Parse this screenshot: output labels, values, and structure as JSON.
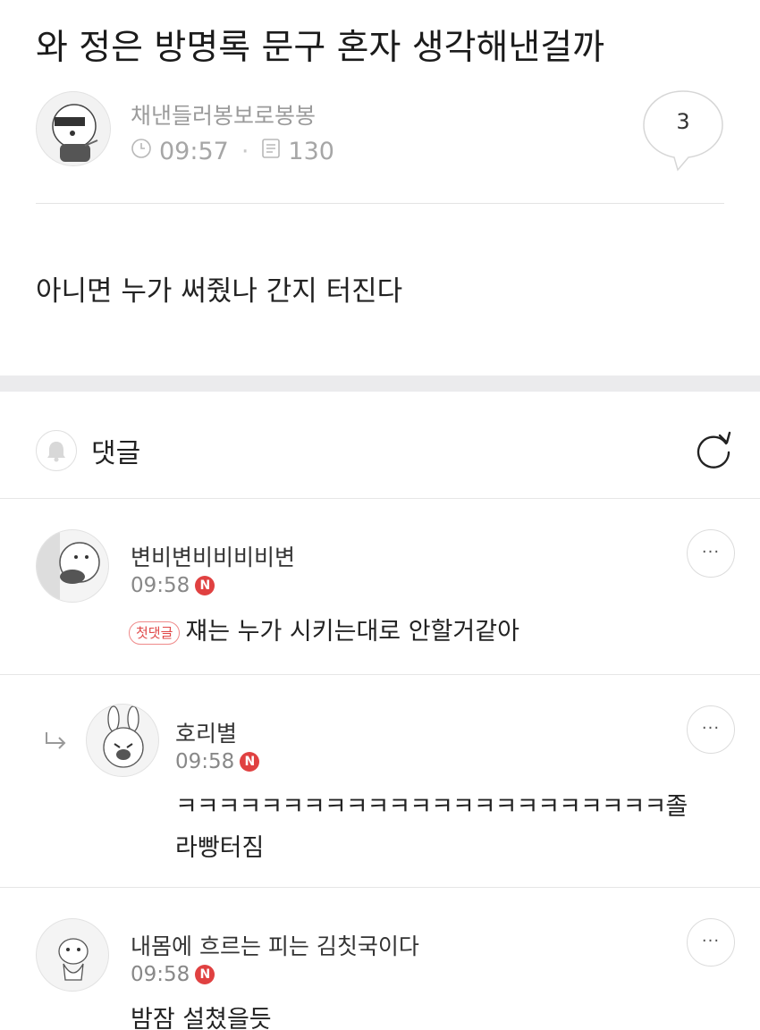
{
  "post": {
    "title": "와 정은 방명록 문구 혼자 생각해낸걸까",
    "author": "채낸들러봉보로봉봉",
    "time": "09:57",
    "views": "130",
    "comment_count": "3",
    "body": "아니면 누가 써줬나 간지 터진다"
  },
  "comments_section": {
    "label": "댓글",
    "items": [
      {
        "name": "변비변비비비비변",
        "time": "09:58",
        "badge": "N",
        "first_comment_label": "첫댓글",
        "text": "쟤는 누가 시키는대로 안할거같아",
        "more": "···"
      },
      {
        "name": "호리별",
        "time": "09:58",
        "badge": "N",
        "text_line1": "ㅋㅋㅋㅋㅋㅋㅋㅋㅋㅋㅋㅋㅋㅋㅋㅋㅋㅋㅋㅋㅋㅋㅋ졸",
        "text_line2": "라빵터짐",
        "more": "···"
      },
      {
        "name": "내몸에 흐르는 피는 김칫국이다",
        "time": "09:58",
        "badge": "N",
        "text": "밤잠 설쳤을듯",
        "more": "···"
      }
    ]
  },
  "icons": {
    "clock": "clock-icon",
    "views": "document-icon",
    "bell": "bell-icon",
    "refresh": "refresh-icon",
    "reply": "reply-arrow-icon"
  },
  "colors": {
    "badge_red": "#e04141",
    "separator": "#ebebed"
  }
}
